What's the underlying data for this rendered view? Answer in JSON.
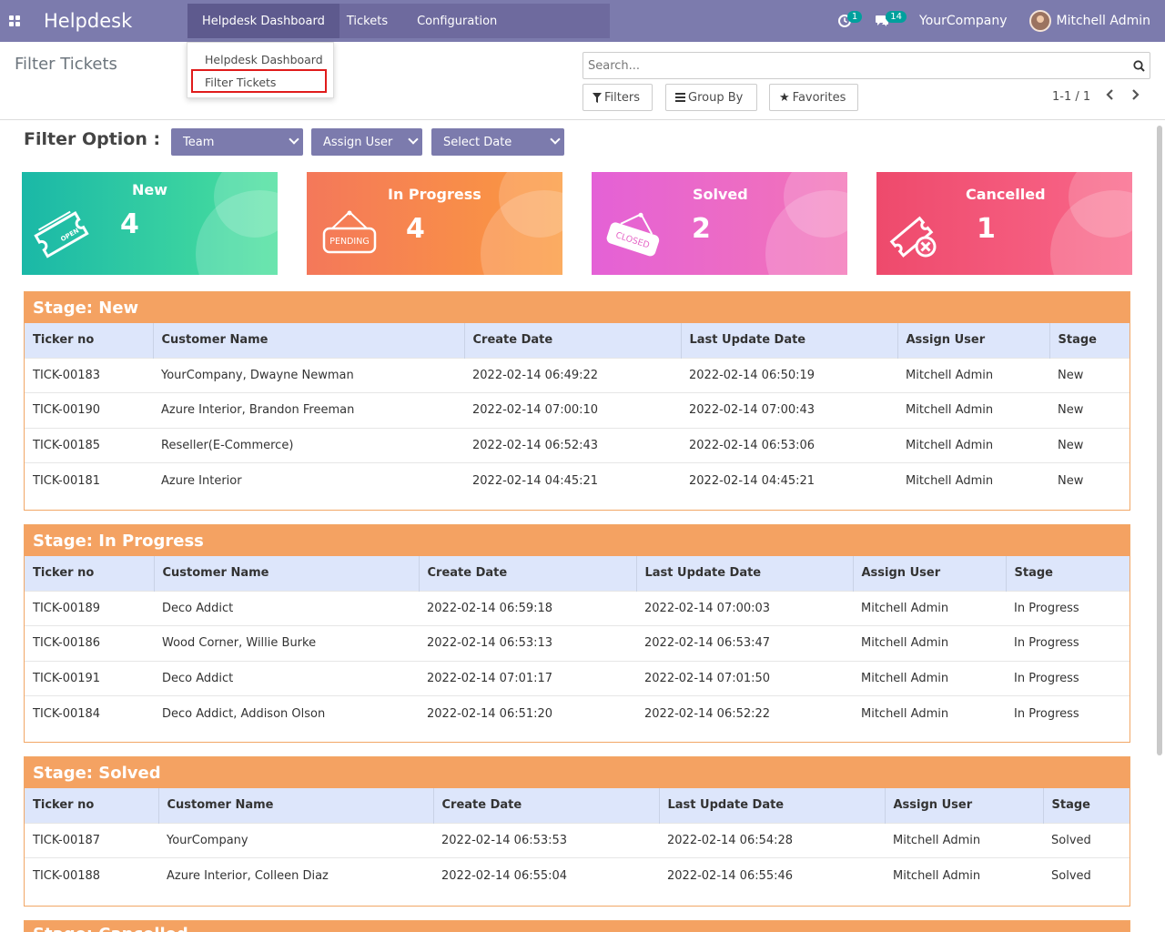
{
  "navbar": {
    "brand": "Helpdesk",
    "menu": [
      "Helpdesk Dashboard",
      "Tickets",
      "Configuration"
    ],
    "activity_count": "1",
    "message_count": "14",
    "company": "YourCompany",
    "user": "Mitchell Admin"
  },
  "dropdown": {
    "items": [
      "Helpdesk Dashboard",
      "Filter Tickets"
    ]
  },
  "control_panel": {
    "title": "Filter Tickets",
    "search_placeholder": "Search...",
    "filters_label": "Filters",
    "groupby_label": "Group By",
    "favorites_label": "Favorites",
    "pager": "1-1 / 1"
  },
  "filter_option": {
    "label": "Filter Option :",
    "selects": [
      "Team",
      "Assign User",
      "Select Date"
    ]
  },
  "cards": [
    {
      "title": "New",
      "count": "4",
      "icon_text": "OPEN",
      "color": "#1fbba6"
    },
    {
      "title": "In Progress",
      "count": "4",
      "icon_text": "PENDING",
      "color": "#f6874f"
    },
    {
      "title": "Solved",
      "count": "2",
      "icon_text": "CLOSED",
      "color": "#ee5fce"
    },
    {
      "title": "Cancelled",
      "count": "1",
      "icon_text": "",
      "color": "#f04d6c"
    }
  ],
  "table_headers": [
    "Ticker no",
    "Customer Name",
    "Create Date",
    "Last Update Date",
    "Assign User",
    "Stage"
  ],
  "stages": [
    {
      "title": "Stage: New",
      "rows": [
        [
          "TICK-00183",
          "YourCompany, Dwayne Newman",
          "2022-02-14 06:49:22",
          "2022-02-14 06:50:19",
          "Mitchell Admin",
          "New"
        ],
        [
          "TICK-00190",
          "Azure Interior, Brandon Freeman",
          "2022-02-14 07:00:10",
          "2022-02-14 07:00:43",
          "Mitchell Admin",
          "New"
        ],
        [
          "TICK-00185",
          "Reseller(E-Commerce)",
          "2022-02-14 06:52:43",
          "2022-02-14 06:53:06",
          "Mitchell Admin",
          "New"
        ],
        [
          "TICK-00181",
          "Azure Interior",
          "2022-02-14 04:45:21",
          "2022-02-14 04:45:21",
          "Mitchell Admin",
          "New"
        ]
      ]
    },
    {
      "title": "Stage: In Progress",
      "rows": [
        [
          "TICK-00189",
          "Deco Addict",
          "2022-02-14 06:59:18",
          "2022-02-14 07:00:03",
          "Mitchell Admin",
          "In Progress"
        ],
        [
          "TICK-00186",
          "Wood Corner, Willie Burke",
          "2022-02-14 06:53:13",
          "2022-02-14 06:53:47",
          "Mitchell Admin",
          "In Progress"
        ],
        [
          "TICK-00191",
          "Deco Addict",
          "2022-02-14 07:01:17",
          "2022-02-14 07:01:50",
          "Mitchell Admin",
          "In Progress"
        ],
        [
          "TICK-00184",
          "Deco Addict, Addison Olson",
          "2022-02-14 06:51:20",
          "2022-02-14 06:52:22",
          "Mitchell Admin",
          "In Progress"
        ]
      ]
    },
    {
      "title": "Stage: Solved",
      "rows": [
        [
          "TICK-00187",
          "YourCompany",
          "2022-02-14 06:53:53",
          "2022-02-14 06:54:28",
          "Mitchell Admin",
          "Solved"
        ],
        [
          "TICK-00188",
          "Azure Interior, Colleen Diaz",
          "2022-02-14 06:55:04",
          "2022-02-14 06:55:46",
          "Mitchell Admin",
          "Solved"
        ]
      ]
    },
    {
      "title": "Stage: Cancelled",
      "rows": []
    }
  ]
}
